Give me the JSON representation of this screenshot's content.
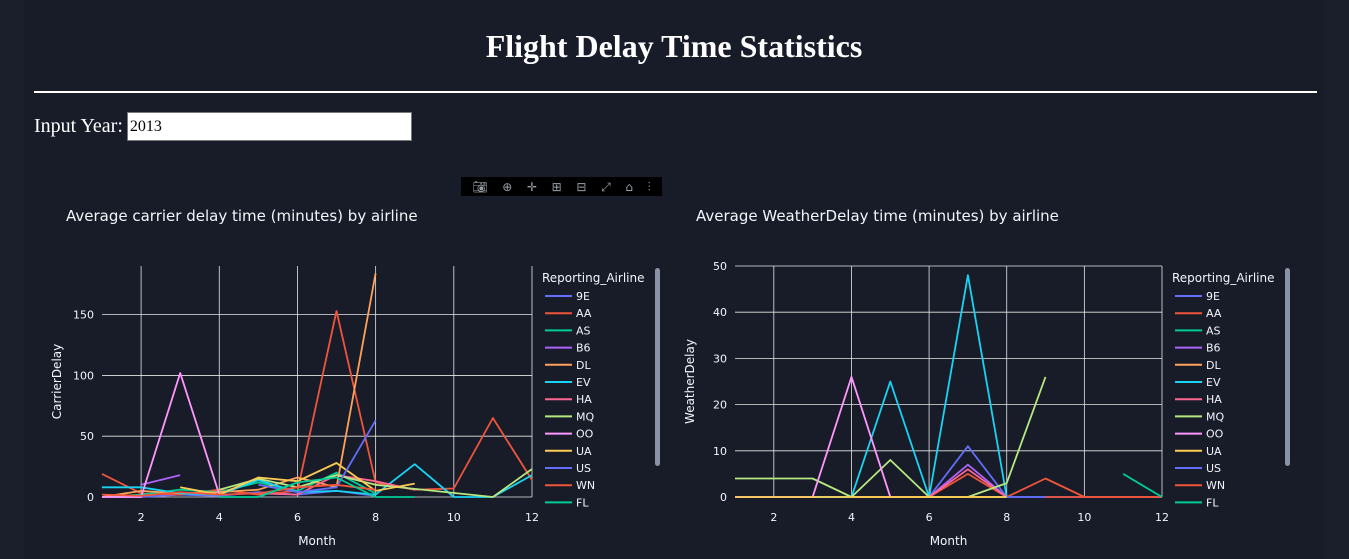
{
  "page": {
    "title": "Flight Delay Time Statistics",
    "input_label": "Input Year:",
    "input_value": "2013"
  },
  "modebar_icons": [
    "camera-icon",
    "zoom-icon",
    "pan-icon",
    "zoom-in-icon",
    "zoom-out-icon",
    "autoscale-icon",
    "home-icon",
    "plotly-logo-icon"
  ],
  "chart_data": [
    {
      "type": "line",
      "title": "Average carrier delay time (minutes) by airline",
      "xlabel": "Month",
      "ylabel": "CarrierDelay",
      "xlim": [
        1,
        12
      ],
      "ylim": [
        0,
        190
      ],
      "xticks": [
        2,
        4,
        6,
        8,
        10,
        12
      ],
      "yticks": [
        0,
        50,
        100,
        150
      ],
      "legend_title": "Reporting_Airline",
      "legend_position": "right",
      "grid": true,
      "series": [
        {
          "name": "9E",
          "color": "#636efa",
          "x": [
            1,
            2,
            3,
            4,
            5,
            6,
            7,
            8
          ],
          "y": [
            0,
            0,
            2,
            1,
            4,
            2,
            5,
            1
          ]
        },
        {
          "name": "AA",
          "color": "#ef553b",
          "x": [
            1,
            2,
            3,
            4,
            5,
            6,
            7,
            8,
            9,
            10,
            11,
            12
          ],
          "y": [
            19,
            3,
            2,
            6,
            2,
            5,
            153,
            12,
            6,
            7,
            65,
            14
          ]
        },
        {
          "name": "AS",
          "color": "#00cc96",
          "x": [
            1,
            2,
            3,
            4,
            5,
            6,
            7,
            8
          ],
          "y": [
            0,
            2,
            6,
            4,
            12,
            5,
            20,
            3
          ]
        },
        {
          "name": "B6",
          "color": "#ab63fa",
          "x": [
            2,
            3
          ],
          "y": [
            10,
            18
          ]
        },
        {
          "name": "DL",
          "color": "#ffa15a",
          "x": [
            1,
            2,
            3,
            4,
            5,
            6,
            7,
            8
          ],
          "y": [
            0,
            5,
            3,
            4,
            6,
            16,
            8,
            184
          ]
        },
        {
          "name": "EV",
          "color": "#19d3f3",
          "x": [
            1,
            2,
            3,
            4,
            5,
            6,
            7,
            8,
            9,
            10,
            11,
            12
          ],
          "y": [
            8,
            8,
            3,
            2,
            14,
            4,
            5,
            2,
            27,
            0,
            0,
            18
          ]
        },
        {
          "name": "HA",
          "color": "#ff6692",
          "x": [
            5,
            6,
            7,
            8,
            9
          ],
          "y": [
            3,
            2,
            18,
            13,
            6
          ]
        },
        {
          "name": "MQ",
          "color": "#b6e880",
          "x": [
            4,
            5,
            6,
            7,
            8,
            11,
            12
          ],
          "y": [
            6,
            15,
            8,
            18,
            10,
            0,
            23
          ]
        },
        {
          "name": "OO",
          "color": "#ff97ff",
          "x": [
            1,
            2,
            3,
            4
          ],
          "y": [
            0,
            0,
            102,
            2
          ]
        },
        {
          "name": "UA",
          "color": "#fecb52",
          "x": [
            3,
            4,
            5,
            6,
            7,
            8,
            9
          ],
          "y": [
            8,
            2,
            16,
            13,
            28,
            5,
            11
          ]
        },
        {
          "name": "US",
          "color": "#636efa",
          "x": [
            5,
            6,
            7,
            8
          ],
          "y": [
            10,
            4,
            8,
            63
          ]
        },
        {
          "name": "WN",
          "color": "#ef553b",
          "x": [
            1,
            2,
            3,
            4,
            5,
            6,
            7,
            8
          ],
          "y": [
            2,
            1,
            4,
            2,
            3,
            8,
            10,
            6
          ]
        },
        {
          "name": "FL",
          "color": "#00cc96",
          "x": [
            4,
            5,
            6,
            7,
            8,
            9
          ],
          "y": [
            0,
            0,
            12,
            16,
            0,
            0
          ]
        }
      ]
    },
    {
      "type": "line",
      "title": "Average WeatherDelay time (minutes) by airline",
      "xlabel": "Month",
      "ylabel": "WeatherDelay",
      "xlim": [
        1,
        12
      ],
      "ylim": [
        0,
        50
      ],
      "xticks": [
        2,
        4,
        6,
        8,
        10,
        12
      ],
      "yticks": [
        0,
        10,
        20,
        30,
        40,
        50
      ],
      "legend_title": "Reporting_Airline",
      "legend_position": "right",
      "grid": true,
      "series": [
        {
          "name": "9E",
          "color": "#636efa",
          "x": [
            1,
            2,
            3,
            4,
            5,
            6,
            7,
            8,
            9,
            10,
            11,
            12
          ],
          "y": [
            0,
            0,
            0,
            0,
            0,
            0,
            11,
            0,
            0,
            0,
            0,
            0
          ]
        },
        {
          "name": "AA",
          "color": "#ef553b",
          "x": [
            1,
            2,
            3,
            4,
            5,
            6,
            7,
            8,
            9,
            10,
            11,
            12
          ],
          "y": [
            0,
            0,
            0,
            0,
            0,
            0,
            5,
            0,
            4,
            0,
            0,
            0
          ]
        },
        {
          "name": "AS",
          "color": "#00cc96",
          "x": [
            1,
            2,
            3,
            4,
            5,
            6,
            7,
            8
          ],
          "y": [
            0,
            0,
            0,
            0,
            0,
            0,
            0,
            0
          ]
        },
        {
          "name": "B6",
          "color": "#ab63fa",
          "x": [
            6,
            7,
            8
          ],
          "y": [
            0,
            7,
            0
          ]
        },
        {
          "name": "DL",
          "color": "#ffa15a",
          "x": [
            1,
            2,
            3,
            4,
            5,
            6,
            7,
            8
          ],
          "y": [
            0,
            0,
            0,
            0,
            0,
            0,
            0,
            0
          ]
        },
        {
          "name": "EV",
          "color": "#19d3f3",
          "x": [
            1,
            2,
            3,
            4,
            5,
            6,
            7,
            8
          ],
          "y": [
            0,
            0,
            0,
            0,
            25,
            0,
            48,
            0
          ]
        },
        {
          "name": "HA",
          "color": "#ff6692",
          "x": [
            6,
            7,
            8
          ],
          "y": [
            0,
            6,
            0
          ]
        },
        {
          "name": "MQ",
          "color": "#b6e880",
          "x": [
            1,
            2,
            3,
            4,
            5,
            6,
            7,
            8,
            9
          ],
          "y": [
            4,
            4,
            4,
            0,
            8,
            0,
            0,
            3,
            26
          ]
        },
        {
          "name": "OO",
          "color": "#ff97ff",
          "x": [
            1,
            2,
            3,
            4,
            5
          ],
          "y": [
            0,
            0,
            0,
            26,
            0
          ]
        },
        {
          "name": "UA",
          "color": "#fecb52",
          "x": [
            1,
            2,
            3,
            4,
            5,
            6,
            7,
            8
          ],
          "y": [
            0,
            0,
            0,
            0,
            0,
            0,
            0,
            0
          ]
        },
        {
          "name": "US",
          "color": "#636efa",
          "x": [
            8,
            9
          ],
          "y": [
            0,
            0
          ]
        },
        {
          "name": "WN",
          "color": "#ef553b",
          "x": [
            9,
            10,
            11,
            12
          ],
          "y": [
            0,
            0,
            0,
            0
          ]
        },
        {
          "name": "FL",
          "color": "#00cc96",
          "x": [
            11,
            12
          ],
          "y": [
            5,
            0
          ]
        }
      ]
    }
  ]
}
